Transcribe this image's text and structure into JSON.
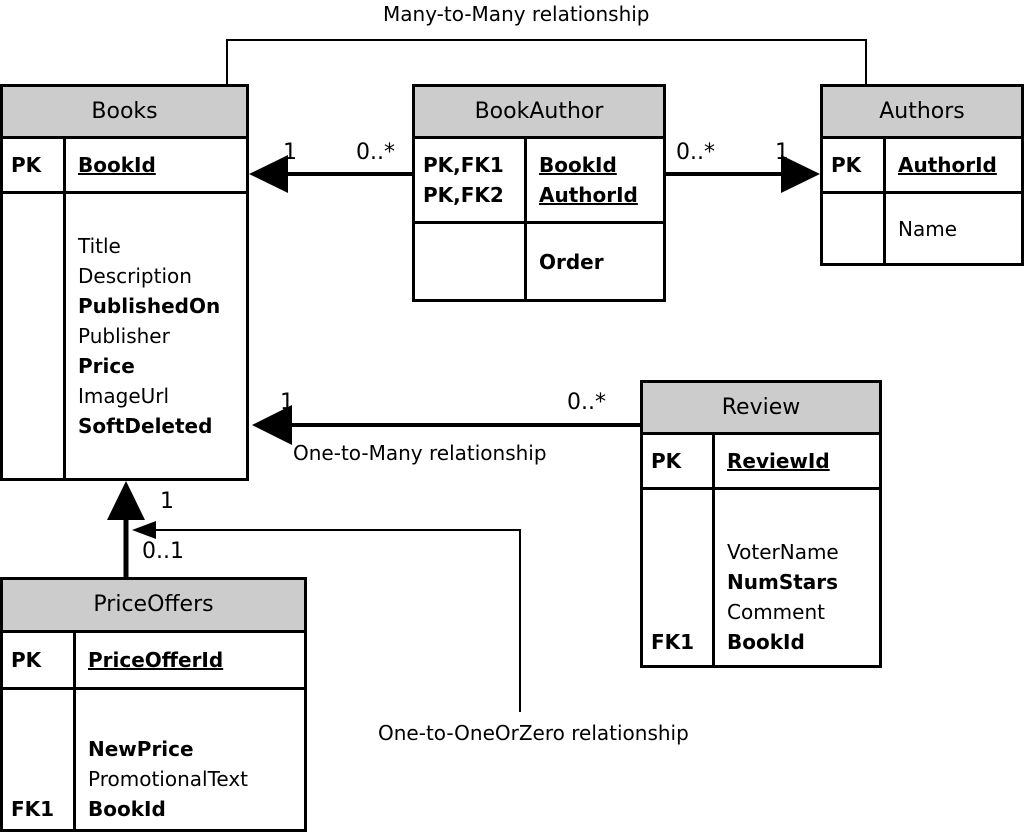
{
  "diagram": {
    "title_note": "Entity relationship diagram",
    "entities": [
      {
        "id": "books",
        "name": "Books",
        "key_rows": [
          "PK"
        ],
        "pk_fields": [
          "BookId"
        ],
        "body_keys": [],
        "body_fields": [
          {
            "text": "Title",
            "bold": false
          },
          {
            "text": "Description",
            "bold": false
          },
          {
            "text": "PublishedOn",
            "bold": true
          },
          {
            "text": "Publisher",
            "bold": false
          },
          {
            "text": "Price",
            "bold": true
          },
          {
            "text": "ImageUrl",
            "bold": false
          },
          {
            "text": "SoftDeleted",
            "bold": true
          }
        ]
      },
      {
        "id": "bookauthor",
        "name": "BookAuthor",
        "key_rows": [
          "PK,FK1",
          "PK,FK2"
        ],
        "pk_fields": [
          "BookId",
          "AuthorId"
        ],
        "body_keys": [],
        "body_fields": [
          {
            "text": "Order",
            "bold": true
          }
        ]
      },
      {
        "id": "authors",
        "name": "Authors",
        "key_rows": [
          "PK"
        ],
        "pk_fields": [
          "AuthorId"
        ],
        "body_keys": [],
        "body_fields": [
          {
            "text": "Name",
            "bold": false
          }
        ]
      },
      {
        "id": "review",
        "name": "Review",
        "key_rows": [
          "PK"
        ],
        "pk_fields": [
          "ReviewId"
        ],
        "body_keys": [
          "FK1"
        ],
        "body_fields": [
          {
            "text": "VoterName",
            "bold": false
          },
          {
            "text": "NumStars",
            "bold": true
          },
          {
            "text": "Comment",
            "bold": false
          },
          {
            "text": "BookId",
            "bold": true
          }
        ]
      },
      {
        "id": "priceoffers",
        "name": "PriceOffers",
        "key_rows": [
          "PK"
        ],
        "pk_fields": [
          "PriceOfferId"
        ],
        "body_keys": [
          "FK1"
        ],
        "body_fields": [
          {
            "text": "NewPrice",
            "bold": true
          },
          {
            "text": "PromotionalText",
            "bold": false
          },
          {
            "text": "BookId",
            "bold": true
          }
        ]
      }
    ],
    "relationships": [
      {
        "id": "many-to-many",
        "label": "Many-to-Many relationship"
      },
      {
        "id": "one-to-many",
        "label": "One-to-Many relationship"
      },
      {
        "id": "one-to-onezero",
        "label": "One-to-OneOrZero relationship"
      }
    ],
    "cardinalities": {
      "books_bookauthor_books_side": "1",
      "books_bookauthor_join_side": "0..*",
      "authors_bookauthor_join_side": "0..*",
      "authors_bookauthor_authors_side": "1",
      "books_review_books_side": "1",
      "books_review_review_side": "0..*",
      "books_priceoffers_books_side": "1",
      "books_priceoffers_offers_side": "0..1"
    },
    "colors": {
      "header_fill": "#cccccc",
      "line": "#000000",
      "background": "#ffffff"
    }
  }
}
